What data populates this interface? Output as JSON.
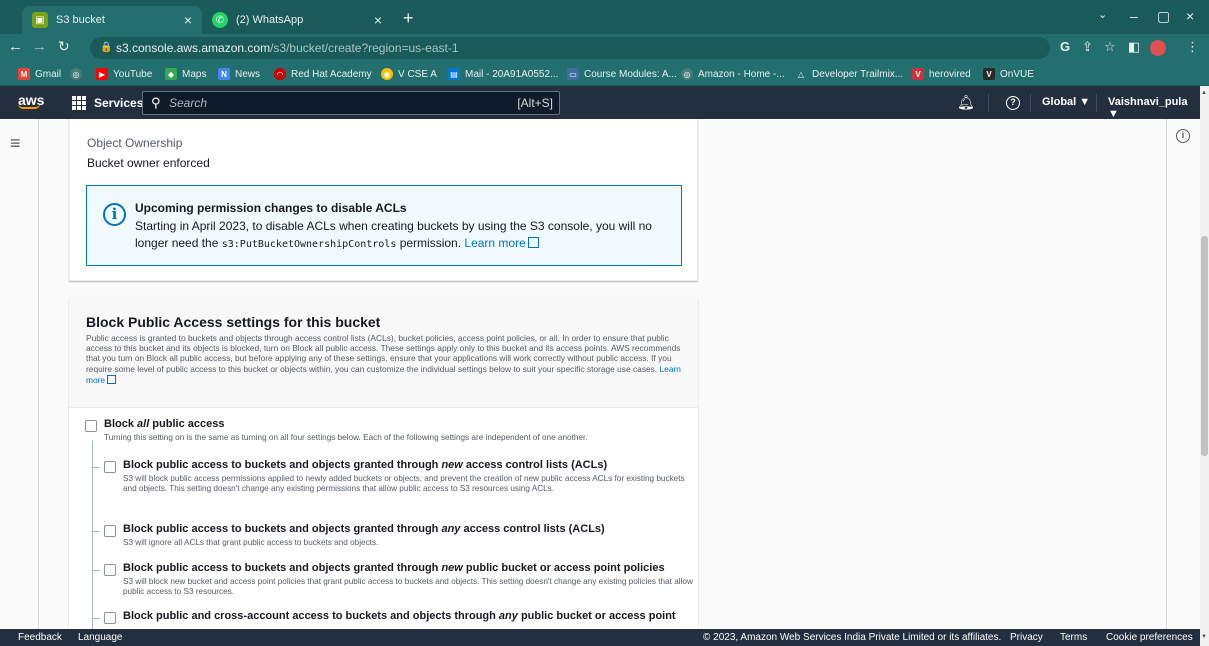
{
  "browser": {
    "tabs": [
      {
        "title": "S3 bucket",
        "active": true
      },
      {
        "title": "(2) WhatsApp",
        "active": false
      }
    ],
    "url_host": "s3.console.aws.amazon.com",
    "url_path": "/s3/bucket/create?region=us-east-1",
    "bookmarks": [
      "Gmail",
      "YouTube",
      "Maps",
      "News",
      "Red Hat Academy",
      "V CSE A",
      "Mail - 20A91A0552...",
      "Course Modules: A...",
      "Amazon - Home -...",
      "Developer Trailmix...",
      "herovired",
      "OnVUE"
    ]
  },
  "aws_header": {
    "logo": "aws",
    "services": "Services",
    "search_placeholder": "Search",
    "search_shortcut": "[Alt+S]",
    "region": "Global ▼",
    "user": "Vaishnavi_pula ▼"
  },
  "ownership": {
    "label": "Object Ownership",
    "value": "Bucket owner enforced",
    "alert_title": "Upcoming permission changes to disable ACLs",
    "alert_text_1": "Starting in April 2023, to disable ACLs when creating buckets by using the S3 console, you will no longer need the ",
    "alert_code": "s3:PutBucketOwnershipControls",
    "alert_text_2": " permission. ",
    "alert_link": "Learn more"
  },
  "block_public": {
    "title": "Block Public Access settings for this bucket",
    "description": "Public access is granted to buckets and objects through access control lists (ACLs), bucket policies, access point policies, or all. In order to ensure that public access to this bucket and its objects is blocked, turn on Block all public access. These settings apply only to this bucket and its access points. AWS recommends that you turn on Block all public access, but before applying any of these settings, ensure that your applications will work correctly without public access. If you require some level of public access to this bucket or objects within, you can customize the individual settings below to suit your specific storage use cases. ",
    "learn_more": "Learn more",
    "all": {
      "label_pre": "Block ",
      "label_em": "all",
      "label_post": " public access",
      "desc": "Turning this setting on is the same as turning on all four settings below. Each of the following settings are independent of one another."
    },
    "options": [
      {
        "pre": "Block public access to buckets and objects granted through ",
        "em": "new",
        "post": " access control lists (ACLs)",
        "desc": "S3 will block public access permissions applied to newly added buckets or objects, and prevent the creation of new public access ACLs for existing buckets and objects. This setting doesn't change any existing permissions that allow public access to S3 resources using ACLs."
      },
      {
        "pre": "Block public access to buckets and objects granted through ",
        "em": "any",
        "post": " access control lists (ACLs)",
        "desc": "S3 will ignore all ACLs that grant public access to buckets and objects."
      },
      {
        "pre": "Block public access to buckets and objects granted through ",
        "em": "new",
        "post": " public bucket or access point policies",
        "desc": "S3 will block new bucket and access point policies that grant public access to buckets and objects. This setting doesn't change any existing policies that allow public access to S3 resources."
      },
      {
        "pre": "Block public and cross-account access to buckets and objects through ",
        "em": "any",
        "post": " public bucket or access point",
        "desc": ""
      }
    ]
  },
  "footer": {
    "feedback": "Feedback",
    "language": "Language",
    "copyright": "© 2023, Amazon Web Services India Private Limited or its affiliates.",
    "privacy": "Privacy",
    "terms": "Terms",
    "cookies": "Cookie preferences"
  }
}
